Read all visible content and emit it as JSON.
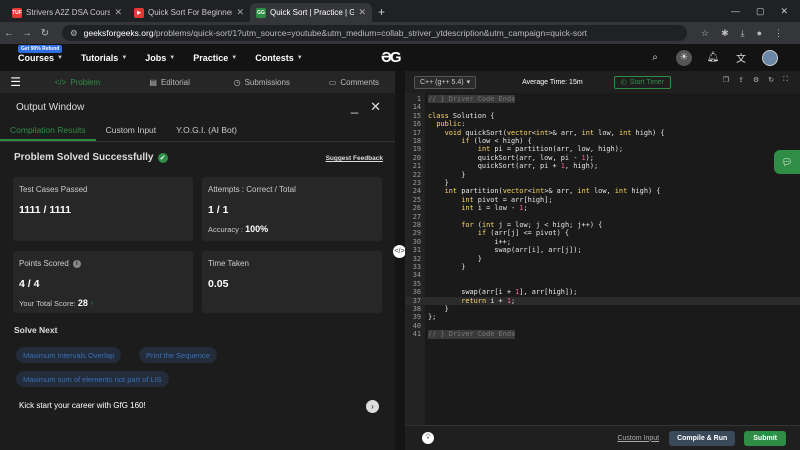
{
  "browser": {
    "tabs": [
      {
        "title": "Strivers A2Z DSA Course/Sheet",
        "favicon_color": "#e53935",
        "favicon_text": "TUF"
      },
      {
        "title": "Quick Sort For Beginners | Striv",
        "favicon_color": "#e53935",
        "favicon_text": "▶"
      },
      {
        "title": "Quick Sort | Practice | GeeksforG",
        "favicon_color": "#2f8d46",
        "favicon_text": "GG"
      }
    ],
    "new_tab": "+",
    "url_host": "geeksforgeeks.org",
    "url_path": "/problems/quick-sort/1?utm_source=youtube&utm_medium=collab_striver_ytdescription&utm_campaign=quick-sort"
  },
  "gfg_nav": {
    "badge": "Get 90% Refund",
    "items": [
      "Courses",
      "Tutorials",
      "Jobs",
      "Practice",
      "Contests"
    ],
    "logo": "ƏG"
  },
  "left_tabs": [
    "Problem",
    "Editorial",
    "Submissions",
    "Comments"
  ],
  "output": {
    "title": "Output Window",
    "subtabs": [
      "Compilation Results",
      "Custom Input",
      "Y.O.G.I. (AI Bot)"
    ],
    "status": "Problem Solved Successfully",
    "feedback": "Suggest Feedback",
    "cards": {
      "tests_label": "Test Cases Passed",
      "tests_value": "1111 / 1111",
      "attempts_label": "Attempts : Correct / Total",
      "attempts_value": "1 / 1",
      "accuracy_label": "Accuracy :",
      "accuracy_value": "100%",
      "points_label": "Points Scored",
      "points_value": "4 / 4",
      "total_label": "Your Total Score:",
      "total_value": "28",
      "time_label": "Time Taken",
      "time_value": "0.05"
    },
    "solve_next": "Solve Next",
    "suggestions": [
      "Maximum Intervals Overlap",
      "Print the Sequence",
      "Maximum sum of elements not part of LIS"
    ],
    "kickstart": "Kick start your career with GfG 160!"
  },
  "editor": {
    "language": "C++ (g++ 5.4)",
    "avg_time": "Average Time: 15m",
    "start_timer": "Start Timer",
    "lines": [
      {
        "n": "1",
        "t": "// } Driver Code Ends",
        "fold": true
      },
      {
        "n": "14",
        "t": ""
      },
      {
        "n": "15",
        "t": "class Solution {"
      },
      {
        "n": "16",
        "t": "  public:"
      },
      {
        "n": "17",
        "t": "    void quickSort(vector<int>& arr, int low, int high) {"
      },
      {
        "n": "18",
        "t": "        if (low < high) {"
      },
      {
        "n": "19",
        "t": "            int pi = partition(arr, low, high);"
      },
      {
        "n": "20",
        "t": "            quickSort(arr, low, pi - 1);"
      },
      {
        "n": "21",
        "t": "            quickSort(arr, pi + 1, high);"
      },
      {
        "n": "22",
        "t": "        }"
      },
      {
        "n": "23",
        "t": "    }"
      },
      {
        "n": "24",
        "t": "    int partition(vector<int>& arr, int low, int high) {"
      },
      {
        "n": "25",
        "t": "        int pivot = arr[high];"
      },
      {
        "n": "26",
        "t": "        int i = low - 1;"
      },
      {
        "n": "27",
        "t": ""
      },
      {
        "n": "28",
        "t": "        for (int j = low; j < high; j++) {"
      },
      {
        "n": "29",
        "t": "            if (arr[j] <= pivot) {"
      },
      {
        "n": "30",
        "t": "                i++;"
      },
      {
        "n": "31",
        "t": "                swap(arr[i], arr[j]);"
      },
      {
        "n": "32",
        "t": "            }"
      },
      {
        "n": "33",
        "t": "        }"
      },
      {
        "n": "34",
        "t": ""
      },
      {
        "n": "35",
        "t": ""
      },
      {
        "n": "36",
        "t": "        swap(arr[i + 1], arr[high]);"
      },
      {
        "n": "37",
        "t": "        return i + 1;",
        "current": true
      },
      {
        "n": "38",
        "t": "    }"
      },
      {
        "n": "39",
        "t": "};"
      },
      {
        "n": "40",
        "t": ""
      },
      {
        "n": "41",
        "t": "// } Driver Code Ends",
        "fold": true
      }
    ]
  },
  "footer": {
    "custom_input": "Custom Input",
    "compile": "Compile & Run",
    "submit": "Submit"
  }
}
